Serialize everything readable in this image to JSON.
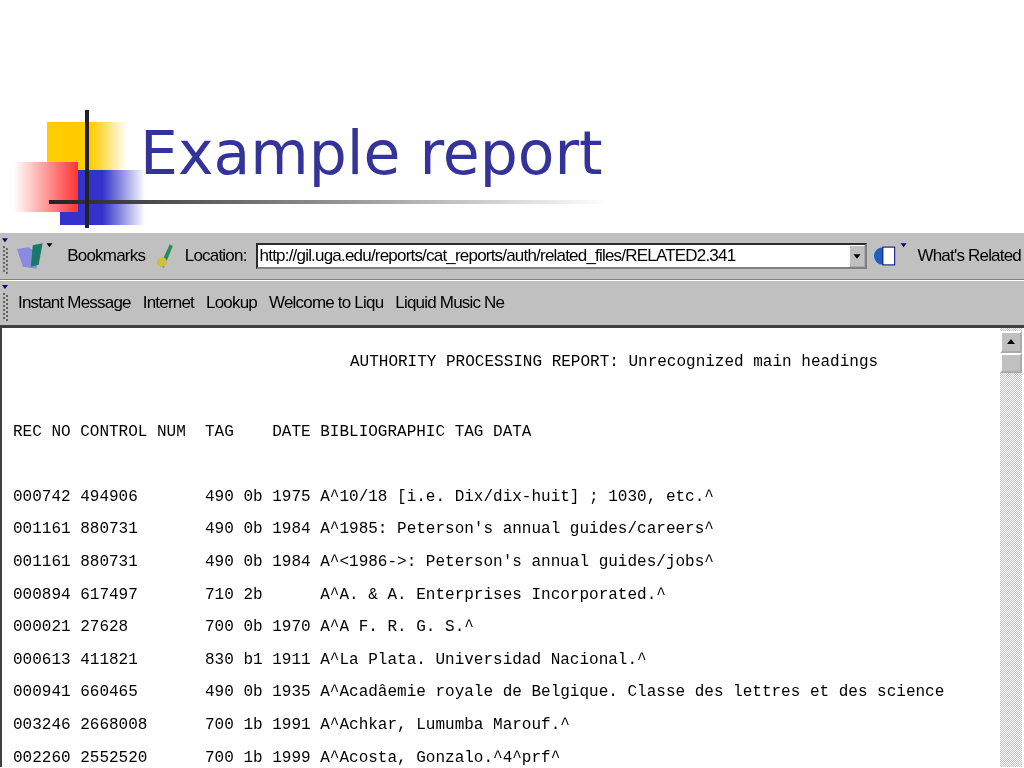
{
  "slide": {
    "title": "Example report"
  },
  "browser": {
    "nav_toolbar": {
      "bookmarks": "Bookmarks",
      "location_label": "Location:",
      "location_value": "http://gil.uga.edu/reports/cat_reports/auth/related_files/RELATED2.341",
      "whats_related": "What's Related"
    },
    "personal_toolbar": [
      "Instant Message",
      "Internet",
      "Lookup",
      "Welcome to Liqu",
      "Liquid Music Ne"
    ],
    "report": {
      "title": "AUTHORITY PROCESSING REPORT: Unrecognized main headings",
      "columns": [
        "REC NO",
        "CONTROL NUM",
        "TAG",
        "DATE",
        "BIBLIOGRAPHIC TAG DATA"
      ],
      "rows": [
        {
          "rec_no": "000742",
          "control_num": "494906",
          "tag": "490",
          "indicators": "0b",
          "date": "1975",
          "data": "A^10/18 [i.e. Dix/dix-huit] ; 1030, etc.^"
        },
        {
          "rec_no": "001161",
          "control_num": "880731",
          "tag": "490",
          "indicators": "0b",
          "date": "1984",
          "data": "A^1985: Peterson's annual guides/careers^"
        },
        {
          "rec_no": "001161",
          "control_num": "880731",
          "tag": "490",
          "indicators": "0b",
          "date": "1984",
          "data": "A^<1986->: Peterson's annual guides/jobs^"
        },
        {
          "rec_no": "000894",
          "control_num": "617497",
          "tag": "710",
          "indicators": "2b",
          "data": "A^A. & A. Enterprises Incorporated.^"
        },
        {
          "rec_no": "000021",
          "control_num": "27628",
          "tag": "700",
          "indicators": "0b",
          "date": "1970",
          "data": "A^A F. R. G. S.^"
        },
        {
          "rec_no": "000613",
          "control_num": "411821",
          "tag": "830",
          "indicators": "b1",
          "date": "1911",
          "data": "A^La Plata. Universidad Nacional.^"
        },
        {
          "rec_no": "000941",
          "control_num": "660465",
          "tag": "490",
          "indicators": "0b",
          "date": "1935",
          "data": "A^Acadâemie royale de Belgique. Classe des lettres et des science"
        },
        {
          "rec_no": "003246",
          "control_num": "2668008",
          "tag": "700",
          "indicators": "1b",
          "date": "1991",
          "data": "A^Achkar, Lumumba Marouf.^"
        },
        {
          "rec_no": "002260",
          "control_num": "2552520",
          "tag": "700",
          "indicators": "1b",
          "date": "1999",
          "data": "A^Acosta, Gonzalo.^4^prf^"
        }
      ]
    }
  }
}
